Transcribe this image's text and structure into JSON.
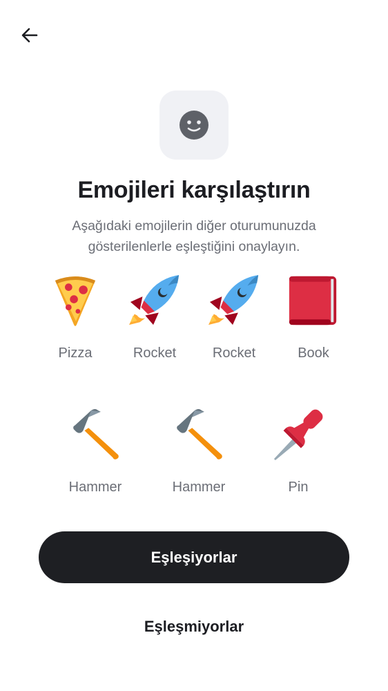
{
  "nav": {
    "back_icon": "arrow-left-icon"
  },
  "header": {
    "icon": "smiley-face-icon",
    "title": "Emojileri karşılaştırın",
    "subtitle": "Aşağıdaki emojilerin diğer oturumunuzda gösterilenlerle eşleştiğini onaylayın."
  },
  "emojis_row1": [
    {
      "icon": "pizza-icon",
      "label": "Pizza"
    },
    {
      "icon": "rocket-icon",
      "label": "Rocket"
    },
    {
      "icon": "rocket-icon",
      "label": "Rocket"
    },
    {
      "icon": "book-icon",
      "label": "Book"
    }
  ],
  "emojis_row2": [
    {
      "icon": "hammer-icon",
      "label": "Hammer"
    },
    {
      "icon": "hammer-icon",
      "label": "Hammer"
    },
    {
      "icon": "pin-icon",
      "label": "Pin"
    }
  ],
  "actions": {
    "match_label": "Eşleşiyorlar",
    "no_match_label": "Eşleşmiyorlar"
  },
  "colors": {
    "primary_button_bg": "#1e1f23",
    "icon_box_bg": "#f0f1f5",
    "subtitle_text": "#6b6e76"
  }
}
